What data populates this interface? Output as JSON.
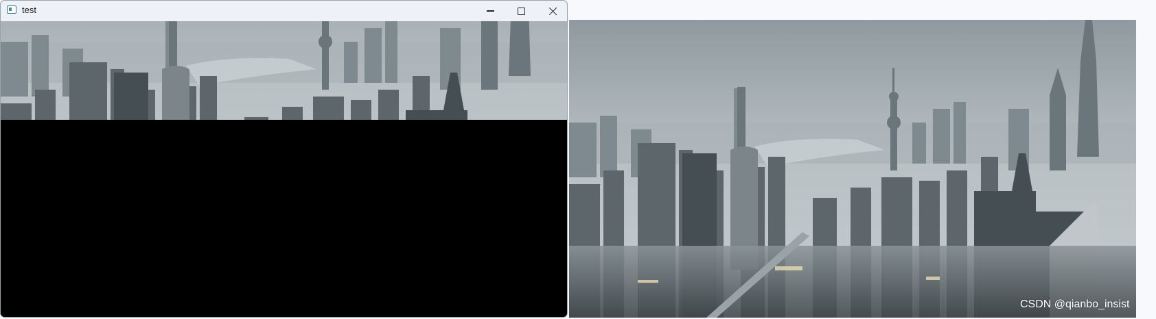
{
  "window": {
    "title": "test",
    "controls": [
      "minimize",
      "maximize",
      "close"
    ],
    "icons": {
      "app": "opencv-window-icon",
      "minimize": "minimize-icon",
      "maximize": "maximize-icon",
      "close": "close-icon"
    }
  },
  "image": {
    "subject": "city-skyline-photo",
    "watermark": "CSDN @qianbo_insist"
  },
  "colors": {
    "titlebar": "#eef2f6",
    "canvas": "#000000",
    "page": "#f7f9fc",
    "sky": "#a7b1b7"
  }
}
